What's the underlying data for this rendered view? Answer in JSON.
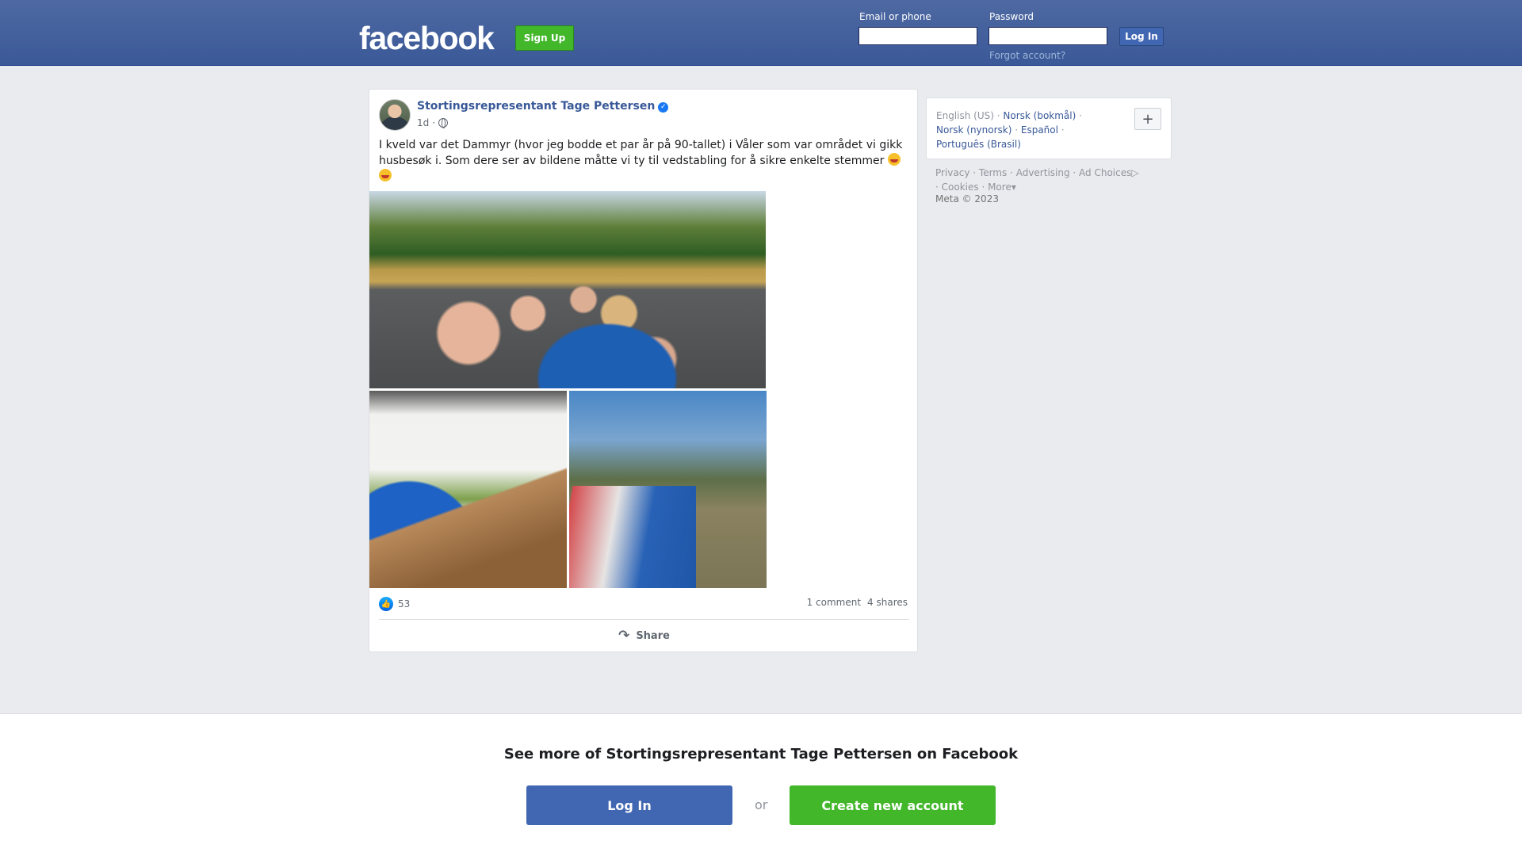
{
  "header": {
    "logo": "facebook",
    "signup_label": "Sign Up",
    "email_label": "Email or phone",
    "email_value": "",
    "password_label": "Password",
    "password_value": "",
    "login_label": "Log In",
    "forgot_label": "Forgot account?"
  },
  "post": {
    "author": "Stortingsrepresentant Tage Pettersen",
    "verified": true,
    "timestamp": "1d",
    "audience_icon": "globe-icon",
    "text": "I kveld var det Dammyr (hvor jeg bodde et par år på 90-tallet) i Våler som var området vi gikk husbesøk i. Som dere ser av bildene måtte vi ty til vedstabling for å sikre enkelte stemmer",
    "reaction_count": "53",
    "comments": "1 comment",
    "shares": "4 shares",
    "share_label": "Share"
  },
  "sidebar": {
    "languages": [
      "English (US)",
      "Norsk (bokmål)",
      "Norsk (nynorsk)",
      "Español",
      "Português (Brasil)"
    ],
    "add_language_label": "+",
    "links": [
      "Privacy",
      "Terms",
      "Advertising",
      "Ad Choices",
      "Cookies",
      "More"
    ],
    "copyright": "Meta © 2023"
  },
  "bottom": {
    "title": "See more of Stortingsrepresentant Tage Pettersen on Facebook",
    "login_label": "Log In",
    "or_label": "or",
    "create_label": "Create new account"
  },
  "colors": {
    "header_blue": "#3b5998",
    "link_blue": "#385898",
    "button_blue": "#4267b2",
    "signup_green": "#42b72a"
  }
}
